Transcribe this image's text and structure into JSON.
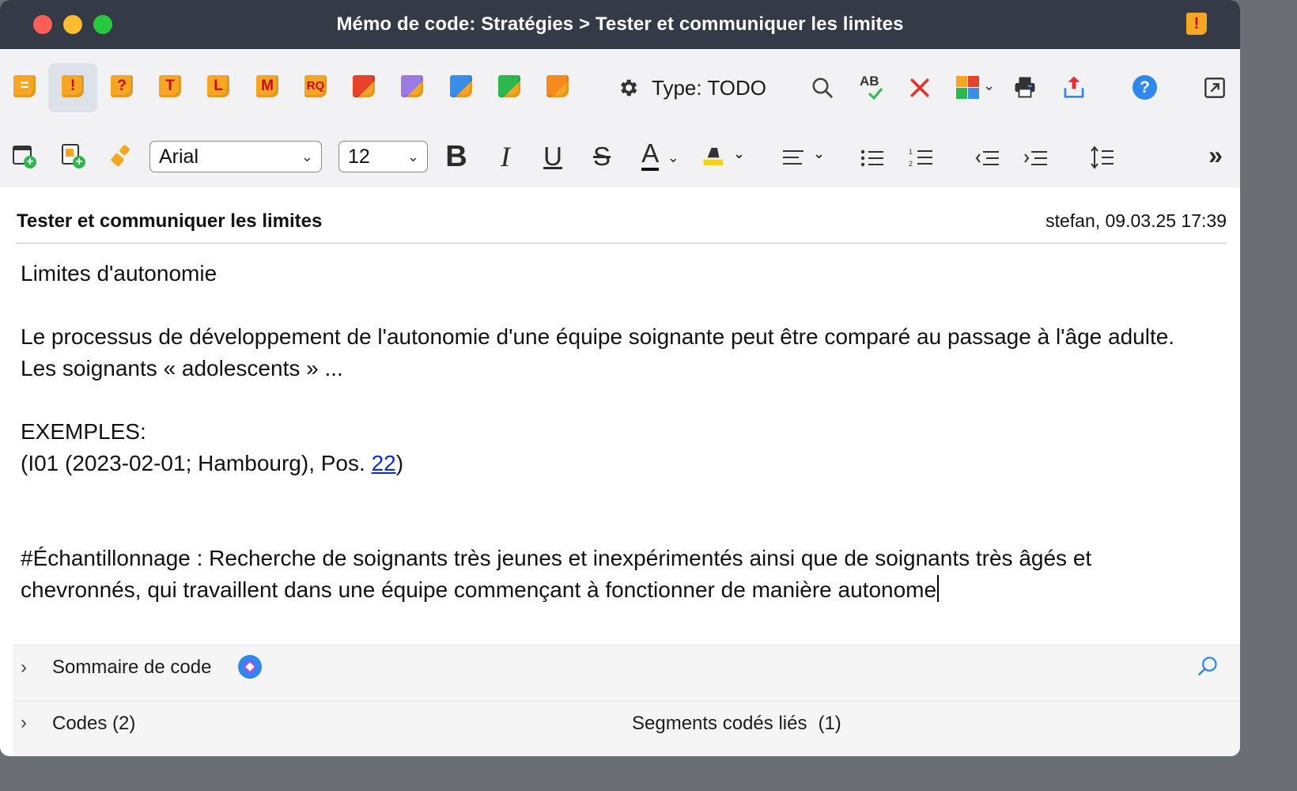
{
  "window": {
    "title": "Mémo de code: Stratégies > Tester et communiquer les limites",
    "badge_symbol": "!"
  },
  "toolbar": {
    "memo_types": [
      {
        "name": "memo-standard",
        "symbol": "=",
        "color": "#f5a623",
        "selected": false
      },
      {
        "name": "memo-important",
        "symbol": "!",
        "color": "#f5a623",
        "selected": true
      },
      {
        "name": "memo-question",
        "symbol": "?",
        "color": "#f5a623",
        "selected": false
      },
      {
        "name": "memo-theory",
        "symbol": "T",
        "color": "#f5a623",
        "selected": false
      },
      {
        "name": "memo-literature",
        "symbol": "L",
        "color": "#f5a623",
        "selected": false
      },
      {
        "name": "memo-method",
        "symbol": "M",
        "color": "#f5a623",
        "selected": false
      },
      {
        "name": "memo-research-question",
        "symbol": "RQ",
        "color": "#f5a623",
        "selected": false
      },
      {
        "name": "memo-red",
        "symbol": "",
        "color": "#e8412c",
        "selected": false
      },
      {
        "name": "memo-purple",
        "symbol": "",
        "color": "#9b7be3",
        "selected": false
      },
      {
        "name": "memo-blue",
        "symbol": "",
        "color": "#3a8ee6",
        "selected": false
      },
      {
        "name": "memo-green",
        "symbol": "",
        "color": "#2db84d",
        "selected": false
      },
      {
        "name": "memo-orange",
        "symbol": "",
        "color": "#f78a1d",
        "selected": false
      }
    ],
    "type_label": "Type: TODO",
    "font_family": "Arial",
    "font_size": "12",
    "bold_label": "B",
    "italic_label": "I",
    "underline_label": "U",
    "strike_label": "S",
    "text_color_label": "A",
    "more_label": "»"
  },
  "document": {
    "title": "Tester et communiquer les limites",
    "meta": "stefan, 09.03.25 17:39",
    "paragraphs": {
      "p1": "Limites d'autonomie",
      "p2": "Le processus de développement de l'autonomie d'une équipe soignante peut être comparé au passage à l'âge adulte. Les soignants « adolescents » ...",
      "p3": "EXEMPLES:",
      "p4_prefix": "(I01 (2023-02-01; Hambourg), Pos. ",
      "p4_link": "22",
      "p4_suffix": ")",
      "p5": "#Échantillonnage : Recherche de soignants très jeunes et inexpérimentés ainsi que de soignants très âgés et chevronnés, qui travaillent dans une équipe commençant à fonctionner de manière autonome"
    }
  },
  "panels": {
    "summary_label": "Sommaire de code",
    "codes_label": "Codes (2)",
    "segments_label": "Segments codés liés",
    "segments_count": "(1)"
  },
  "colors": {
    "titlebar": "#343b47",
    "toolbar_bg": "#f2f2f4",
    "memo_yellow": "#f5a623",
    "link": "#0a2bd6",
    "help_blue": "#2f88ee"
  }
}
